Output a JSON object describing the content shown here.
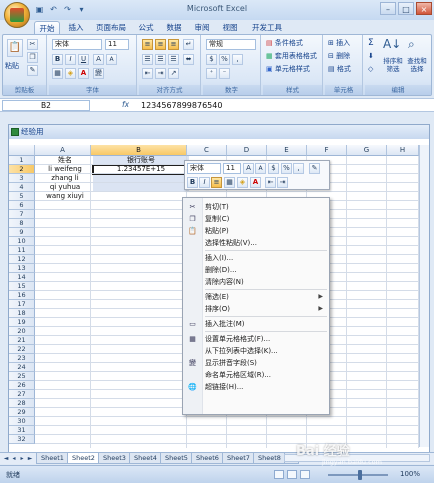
{
  "window": {
    "title": "Microsoft Excel"
  },
  "tabs": [
    "开始",
    "插入",
    "页面布局",
    "公式",
    "数据",
    "审阅",
    "视图",
    "开发工具"
  ],
  "ribbon": {
    "clipboard": {
      "label": "剪贴板",
      "paste": "粘贴"
    },
    "font": {
      "label": "字体",
      "name": "宋体",
      "size": "11",
      "bold": "B",
      "italic": "I",
      "underline": "U",
      "grow": "A",
      "shrink": "A",
      "color": "A",
      "phonetic": "變"
    },
    "alignment": {
      "label": "对齐方式"
    },
    "number": {
      "label": "数字",
      "format": "常规",
      "percent": "%",
      "comma": ","
    },
    "styles": {
      "label": "样式",
      "items": [
        "条件格式",
        "套用表格格式",
        "单元格样式"
      ]
    },
    "cells": {
      "label": "单元格",
      "items": [
        "插入",
        "删除",
        "格式"
      ]
    },
    "editing": {
      "label": "编辑",
      "sum": "Σ",
      "sort": "排序和筛选",
      "find": "查找和选择"
    }
  },
  "formula_bar": {
    "name_box": "B2",
    "fx": "fx",
    "value": "1234567899876540"
  },
  "workbook": {
    "title": "经验用"
  },
  "columns": [
    "A",
    "B",
    "C",
    "D",
    "E",
    "F",
    "G",
    "H"
  ],
  "rows": [
    "1",
    "2",
    "3",
    "4",
    "5",
    "6",
    "7",
    "8",
    "9",
    "10",
    "11",
    "12",
    "13",
    "14",
    "15",
    "16",
    "17",
    "18",
    "19",
    "20",
    "21",
    "22",
    "23",
    "24",
    "25",
    "26",
    "27",
    "28",
    "29",
    "30",
    "31",
    "32",
    "33"
  ],
  "cells": {
    "A1": "姓名",
    "B1": "银行账号",
    "A2": "li weifeng",
    "B2": "1.23457E+15",
    "A3": "zhang li",
    "A4": "qi yuhua",
    "A5": "wang xiuyi"
  },
  "mini_toolbar": {
    "font": "宋体",
    "size": "11",
    "grow": "A",
    "shrink": "A",
    "percent": "%",
    "comma": ",",
    "bold": "B",
    "italic": "I",
    "color": "A"
  },
  "context_menu": [
    {
      "label": "剪切(T)",
      "icon": "scissors-icon",
      "glyph": "✂"
    },
    {
      "label": "复制(C)",
      "icon": "copy-icon",
      "glyph": "❐"
    },
    {
      "label": "粘贴(P)",
      "icon": "paste-icon",
      "glyph": "📋"
    },
    {
      "label": "选择性粘贴(V)...",
      "icon": "",
      "glyph": ""
    },
    {
      "sep": true
    },
    {
      "label": "插入(I)...",
      "icon": "",
      "glyph": ""
    },
    {
      "label": "删除(D)...",
      "icon": "",
      "glyph": ""
    },
    {
      "label": "清除内容(N)",
      "icon": "",
      "glyph": ""
    },
    {
      "sep": true
    },
    {
      "label": "筛选(E)",
      "icon": "",
      "glyph": "",
      "submenu": true
    },
    {
      "label": "排序(O)",
      "icon": "",
      "glyph": "",
      "submenu": true
    },
    {
      "sep": true
    },
    {
      "label": "插入批注(M)",
      "icon": "comment-icon",
      "glyph": "▭"
    },
    {
      "sep": true
    },
    {
      "label": "设置单元格格式(F)...",
      "icon": "format-cells-icon",
      "glyph": "▦"
    },
    {
      "label": "从下拉列表中选择(K)...",
      "icon": "",
      "glyph": ""
    },
    {
      "label": "显示拼音字段(S)",
      "icon": "phonetic-icon",
      "glyph": "變"
    },
    {
      "label": "命名单元格区域(R)...",
      "icon": "",
      "glyph": ""
    },
    {
      "label": "超链接(H)...",
      "icon": "hyperlink-icon",
      "glyph": "🌐"
    }
  ],
  "sheets": [
    "Sheet1",
    "Sheet2",
    "Sheet3",
    "Sheet4",
    "Sheet5",
    "Sheet6",
    "Sheet7",
    "Sheet8"
  ],
  "status": {
    "text": "就绪",
    "zoom": "100%"
  },
  "watermark": {
    "brand": "Bai 经验",
    "url": "jingyan.baidu.com"
  },
  "colors": {
    "accent": "#15428b",
    "selection": "#f8c866"
  }
}
